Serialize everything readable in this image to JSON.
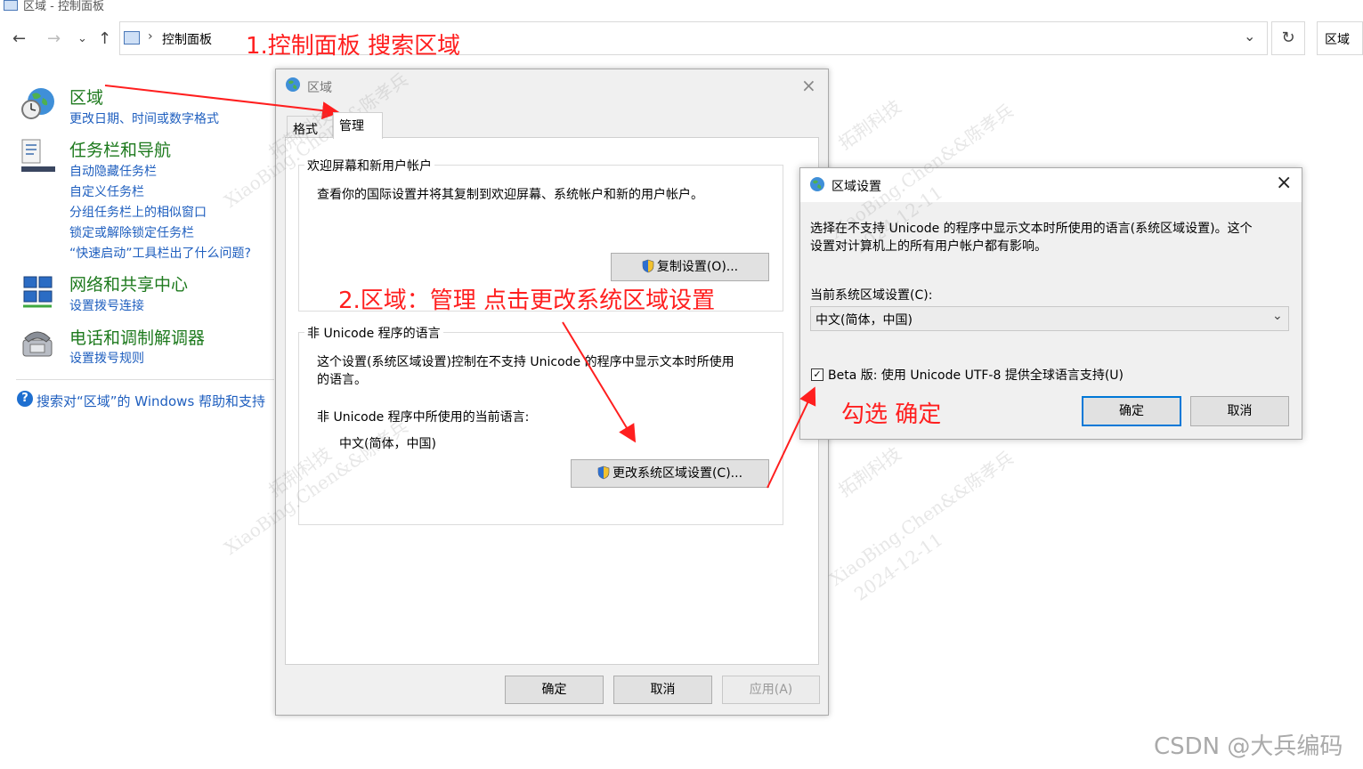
{
  "window": {
    "title": "区域 - 控制面板"
  },
  "nav": {
    "back_icon": "arrow-left-icon",
    "forward_icon": "arrow-right-icon",
    "recent_icon": "chevron-down-icon",
    "up_icon": "arrow-up-icon",
    "breadcrumb": "控制面板",
    "search_value": "区域"
  },
  "annotations": {
    "step1": "1.控制面板 搜索区域",
    "step2": "2.区域：管理 点击更改系统区域设置",
    "step3": "勾选 确定",
    "color": "#ff1f1f"
  },
  "left": {
    "categories": [
      {
        "title": "区域",
        "links": [
          "更改日期、时间或数字格式"
        ]
      },
      {
        "title": "任务栏和导航",
        "links": [
          "自动隐藏任务栏",
          "自定义任务栏",
          "分组任务栏上的相似窗口",
          "锁定或解除锁定任务栏",
          "“快速启动”工具栏出了什么问题?"
        ]
      },
      {
        "title": "网络和共享中心",
        "links": [
          "设置拨号连接"
        ]
      },
      {
        "title": "电话和调制解调器",
        "links": [
          "设置拨号规则"
        ]
      }
    ],
    "help_link": "搜索对“区域”的 Windows 帮助和支持"
  },
  "region_dialog": {
    "title": "区域",
    "tabs": [
      "格式",
      "管理"
    ],
    "welcome_group": {
      "legend": "欢迎屏幕和新用户帐户",
      "text": "查看你的国际设置并将其复制到欢迎屏幕、系统帐户和新的用户帐户。",
      "copy_button": "复制设置(O)..."
    },
    "unicode_group": {
      "legend": "非 Unicode 程序的语言",
      "text_line1": "这个设置(系统区域设置)控制在不支持 Unicode 的程序中显示文本时所使用",
      "text_line2": "的语言。",
      "current_label": "非 Unicode 程序中所使用的当前语言:",
      "current_value": "中文(简体，中国)",
      "change_button": "更改系统区域设置(C)..."
    },
    "buttons": {
      "ok": "确定",
      "cancel": "取消",
      "apply": "应用(A)"
    }
  },
  "locale_dialog": {
    "title": "区域设置",
    "desc_line1": "选择在不支持 Unicode 的程序中显示文本时所使用的语言(系统区域设置)。这个",
    "desc_line2": "设置对计算机上的所有用户帐户都有影响。",
    "current_label": "当前系统区域设置(C):",
    "current_value": "中文(简体，中国)",
    "beta_label": "Beta 版: 使用 Unicode UTF-8 提供全球语言支持(U)",
    "beta_checked": true,
    "ok": "确定",
    "cancel": "取消"
  },
  "watermarks": [
    "拓荆科技",
    "XiaoBing.Chen&&陈孝兵",
    "2024-12-11"
  ],
  "footer": {
    "csdn": "CSDN @大兵编码"
  }
}
